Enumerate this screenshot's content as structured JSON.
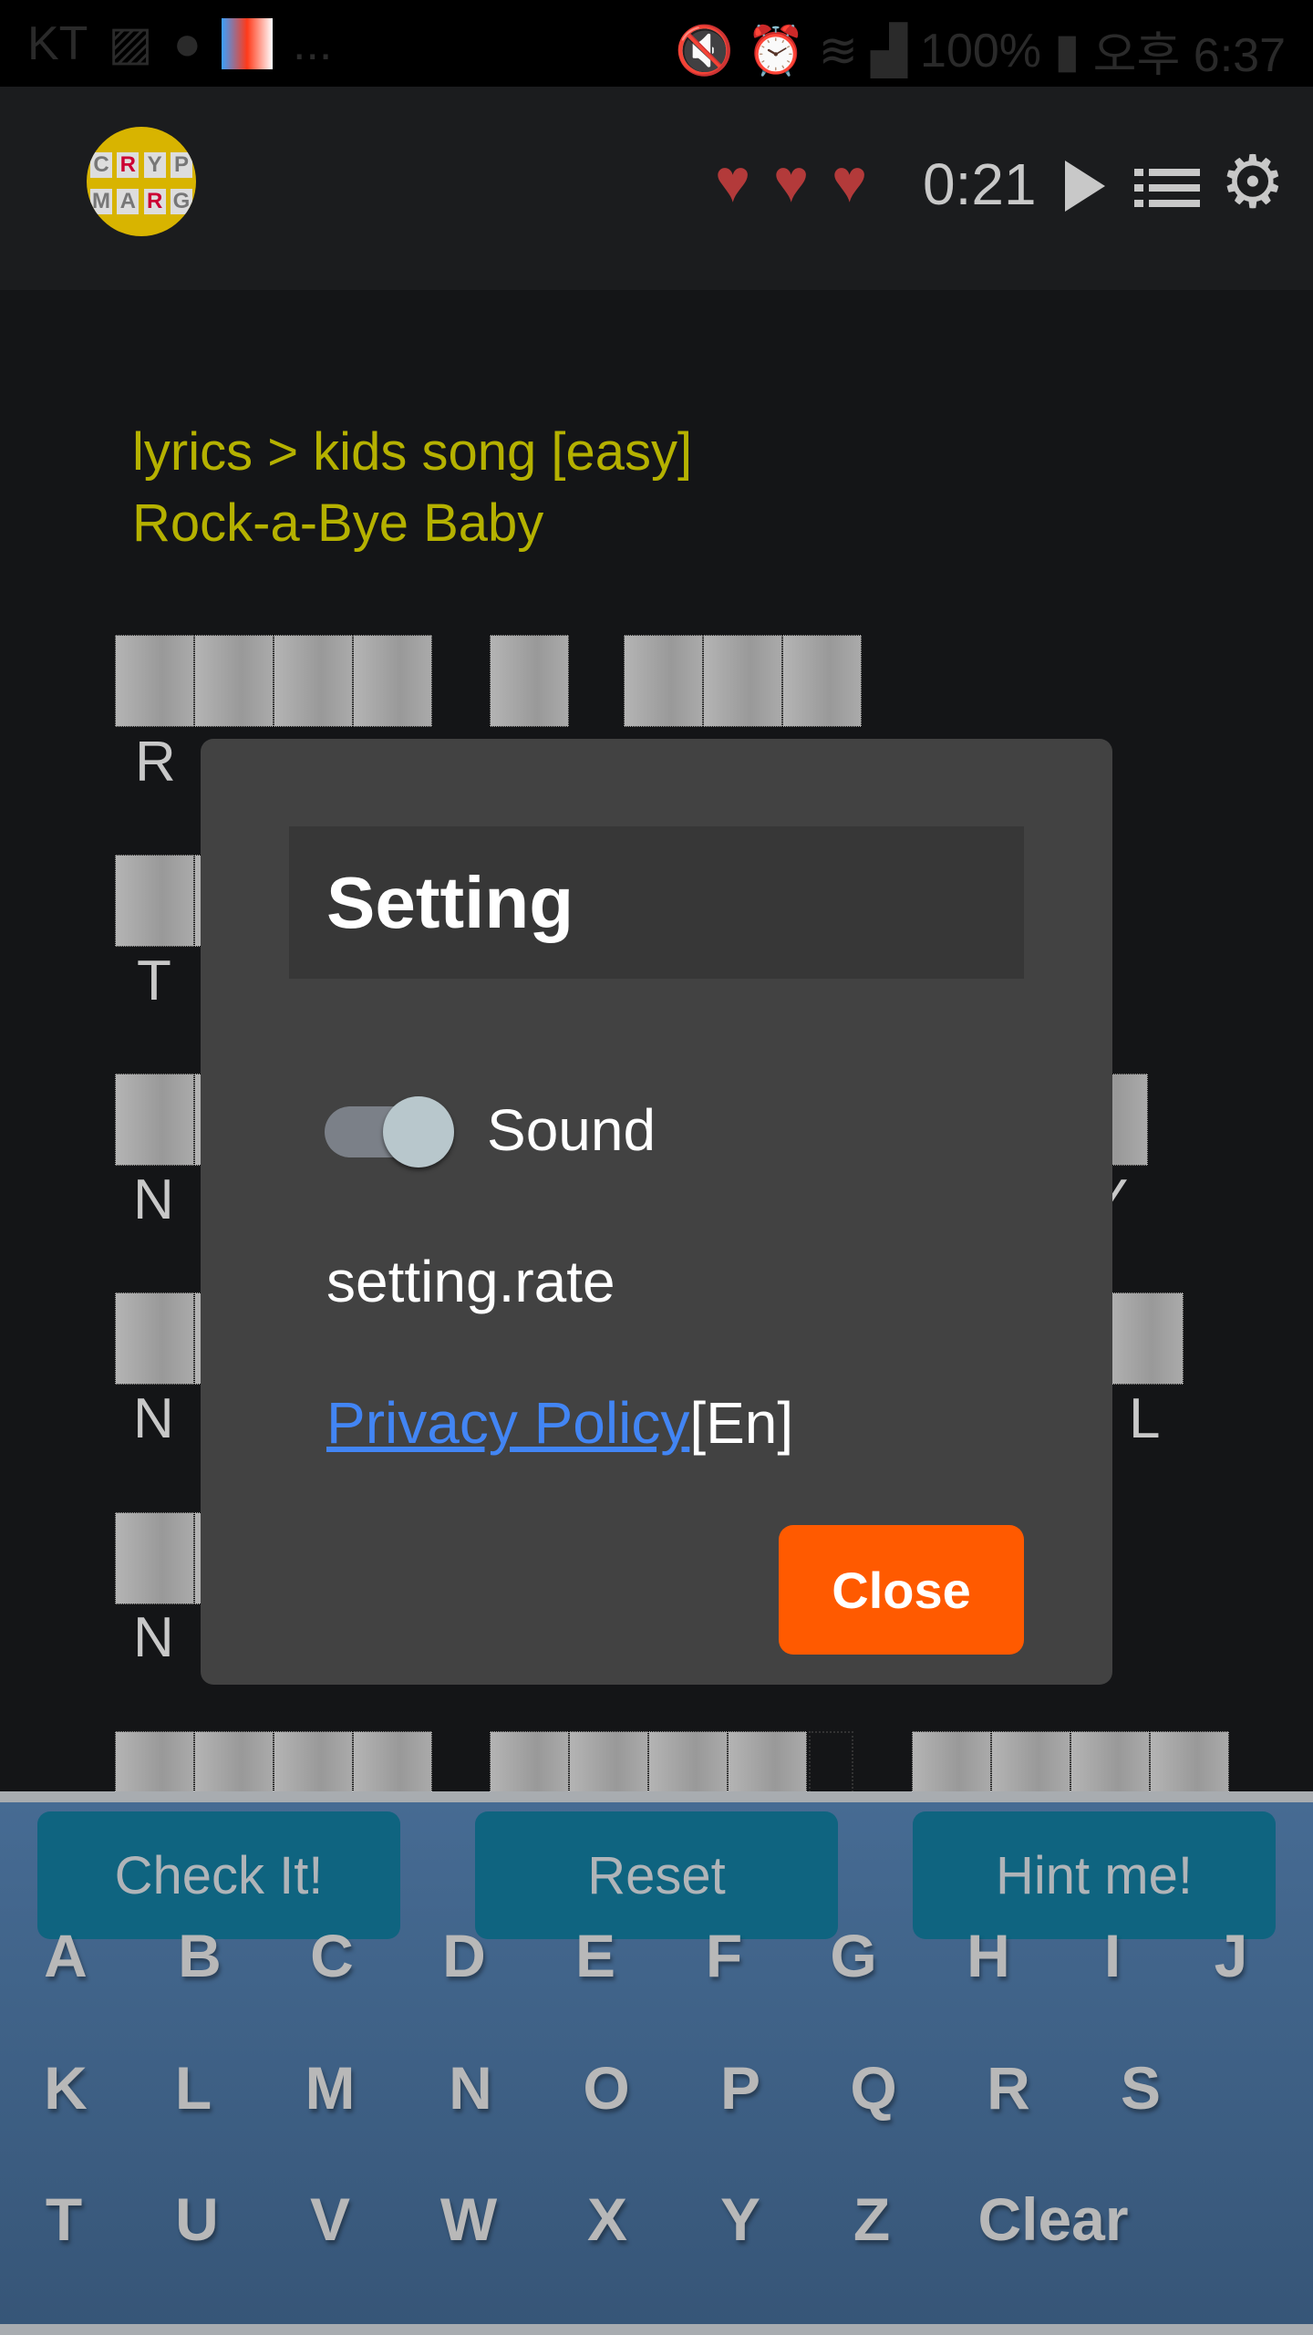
{
  "status_bar": {
    "carrier": "KT",
    "more": "...",
    "battery": "100%",
    "time": "오후 6:37"
  },
  "header": {
    "logo_text": [
      "C",
      "R",
      "Y",
      "P",
      "M",
      "A",
      "R",
      "G"
    ],
    "lives": 3,
    "timer": "0:21",
    "icons": [
      "heart-icon",
      "play-icon",
      "list-icon",
      "gear-icon"
    ]
  },
  "puzzle": {
    "category": "lyrics > kids song [easy]",
    "title": "Rock-a-Bye Baby",
    "hints": {
      "r0": "R",
      "r1": "T",
      "r2": "N",
      "r2b": "Y",
      "r3": "N",
      "r3b": "L",
      "r4": "N"
    }
  },
  "dialog": {
    "title": "Setting",
    "sound_label": "Sound",
    "sound_on": true,
    "rate_label": "setting.rate",
    "privacy_link": "Privacy Policy",
    "privacy_suffix": "[En]",
    "close_label": "Close"
  },
  "keyboard": {
    "actions": [
      "Check It!",
      "Reset",
      "Hint me!"
    ],
    "rows": [
      [
        "A",
        "B",
        "C",
        "D",
        "E",
        "F",
        "G",
        "H",
        "I",
        "J"
      ],
      [
        "K",
        "L",
        "M",
        "N",
        "O",
        "P",
        "Q",
        "R",
        "S"
      ],
      [
        "T",
        "U",
        "V",
        "W",
        "X",
        "Y",
        "Z",
        "Clear"
      ]
    ]
  },
  "colors": {
    "accent": "#ff5a00",
    "link": "#4285f4",
    "category": "#b5b100",
    "heart": "#b33a3a",
    "action_button": "#0f6480"
  }
}
